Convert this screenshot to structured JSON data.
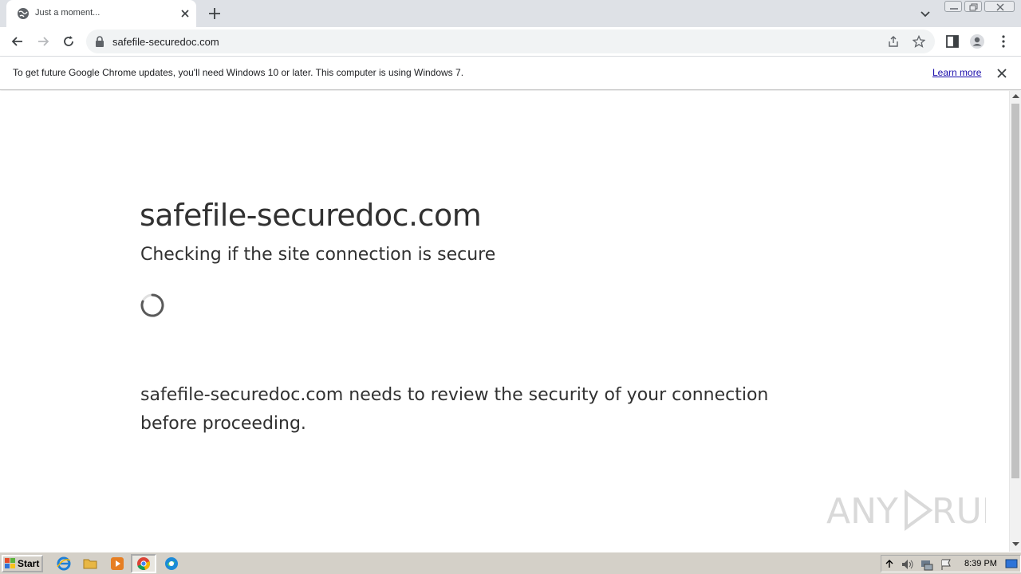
{
  "browser": {
    "tab": {
      "title": "Just a moment...",
      "favicon": "globe-icon"
    },
    "address": {
      "url": "safefile-securedoc.com"
    },
    "infobar": {
      "message": "To get future Google Chrome updates, you'll need Windows 10 or later. This computer is using Windows 7.",
      "link": "Learn more"
    }
  },
  "page": {
    "site_title": "safefile-securedoc.com",
    "subtitle": "Checking if the site connection is secure",
    "review_text": "safefile-securedoc.com needs to review the security of your connection before proceeding."
  },
  "watermark": {
    "text": "ANY RUN"
  },
  "taskbar": {
    "start_label": "Start",
    "clock": "8:39 PM",
    "pinned": [
      "internet-explorer-icon",
      "folder-icon",
      "media-player-icon",
      "chrome-icon",
      "edge-icon"
    ]
  },
  "colors": {
    "accent_link": "#1a0dab",
    "text": "#313131",
    "tabstrip": "#dee1e6"
  }
}
